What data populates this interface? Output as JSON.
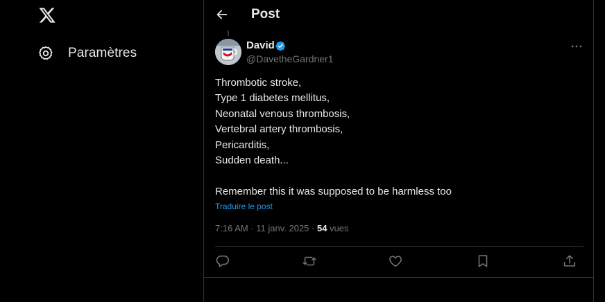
{
  "sidebar": {
    "logo_icon": "x-logo-icon",
    "items": [
      {
        "label": "Paramètres",
        "icon": "gear-icon"
      }
    ]
  },
  "header": {
    "back_icon": "arrow-left-icon",
    "title": "Post"
  },
  "post": {
    "author": {
      "name": "David",
      "handle": "@DavetheGardner1",
      "verified": true,
      "verified_color": "#1d9bf0",
      "avatar_icon": "avatar-image"
    },
    "lines": [
      "Thrombotic stroke,",
      "Type 1 diabetes mellitus,",
      "Neonatal venous thrombosis,",
      "Vertebral artery thrombosis,",
      "Pericarditis,",
      "Sudden death...",
      "",
      "Remember this it was supposed to be harmless too"
    ],
    "translate_label": "Traduire le post",
    "time": "7:16 AM",
    "sep1": " · ",
    "date": "11 janv. 2025",
    "sep2": " · ",
    "views_count": "54",
    "views_label": " vues",
    "actions": [
      "reply-icon",
      "repost-icon",
      "like-icon",
      "bookmark-icon",
      "share-icon"
    ]
  },
  "colors": {
    "background": "#000000",
    "text": "#e7e9ea",
    "muted": "#71767b",
    "accent": "#1d9bf0",
    "border": "#2f3336"
  }
}
